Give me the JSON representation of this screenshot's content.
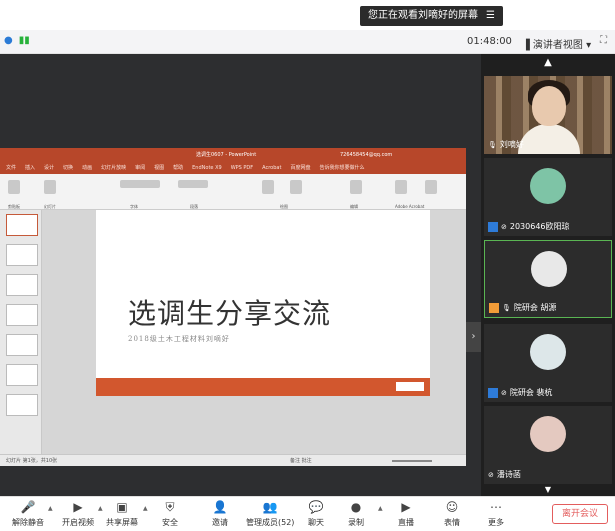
{
  "banner": {
    "text": "您正在观看刘嘀好的屏幕",
    "menu_icon": "menu-icon"
  },
  "meeting_bar": {
    "timer": "01:48:00",
    "view_label": "演讲者视图",
    "view_caret": "▾"
  },
  "ppt": {
    "window_title": "选调生0607 - PowerPoint",
    "account": "726458454@qq.com",
    "tabs": [
      "文件",
      "插入",
      "设计",
      "切换",
      "动画",
      "幻灯片放映",
      "审阅",
      "视图",
      "帮助",
      "EndNote X9",
      "WPS PDF",
      "Acrobat",
      "百度网盘",
      "告诉我你想要做什么"
    ],
    "ribbon_groups": [
      "剪贴板",
      "幻灯片",
      "字体",
      "段落",
      "绘图",
      "编辑",
      "Adobe Acrobat"
    ],
    "slide_title": "选调生分享交流",
    "slide_subtitle": "2018级土木工程材料刘嘀好",
    "status_left": "幻灯片 第1张，共10张",
    "status_right": "备注  批注"
  },
  "participants": [
    {
      "name": "刘嘀好",
      "icon": "mic-icon",
      "tag": "none"
    },
    {
      "name": "2030646欧阳琼",
      "icon": "mic-muted-icon",
      "tag": "blue"
    },
    {
      "name": "院研会 胡源",
      "icon": "mic-icon",
      "tag": "orange"
    },
    {
      "name": "院研会 裴杭",
      "icon": "mic-muted-icon",
      "tag": "blue"
    },
    {
      "name": "潘诗菡",
      "icon": "mic-muted-icon",
      "tag": "none"
    }
  ],
  "toolbar": {
    "items": [
      {
        "label": "解除静音",
        "icon": "mic-muted-icon"
      },
      {
        "label": "开启视频",
        "icon": "video-off-icon"
      },
      {
        "label": "共享屏幕",
        "icon": "share-screen-icon"
      },
      {
        "label": "安全",
        "icon": "shield-icon"
      },
      {
        "label": "邀请",
        "icon": "invite-icon"
      },
      {
        "label": "管理成员(52)",
        "icon": "members-icon"
      },
      {
        "label": "聊天",
        "icon": "chat-icon"
      },
      {
        "label": "录制",
        "icon": "record-icon"
      },
      {
        "label": "直播",
        "icon": "live-icon"
      },
      {
        "label": "表情",
        "icon": "emoji-icon"
      },
      {
        "label": "更多",
        "icon": "more-icon"
      }
    ],
    "leave_label": "离开会议"
  }
}
